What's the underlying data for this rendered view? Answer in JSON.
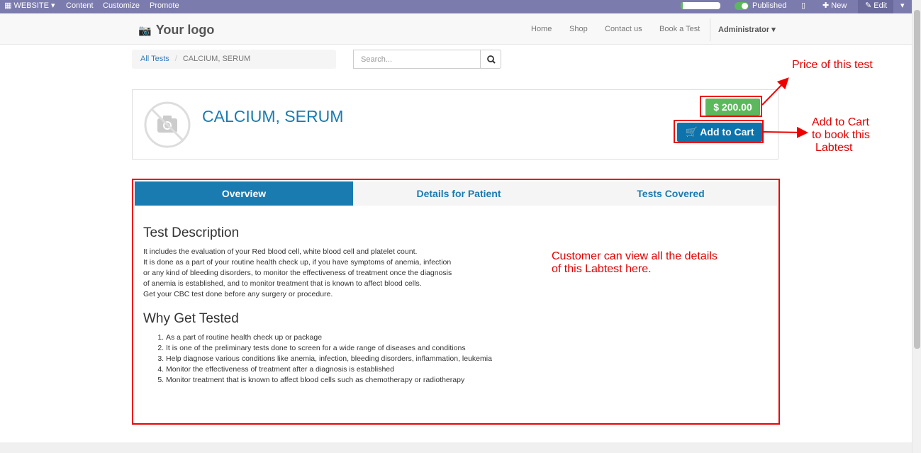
{
  "admin_bar": {
    "website_label": "WEBSITE",
    "content_label": "Content",
    "customize_label": "Customize",
    "promote_label": "Promote",
    "progress": 0.05,
    "published_label": "Published",
    "new_label": "New",
    "edit_label": "Edit"
  },
  "navbar": {
    "logo_text": "Your logo",
    "links": [
      "Home",
      "Shop",
      "Contact us",
      "Book a Test"
    ],
    "user_label": "Administrator"
  },
  "breadcrumb": {
    "root": "All Tests",
    "current": "CALCIUM, SERUM"
  },
  "search": {
    "placeholder": "Search..."
  },
  "product": {
    "title": "CALCIUM, SERUM",
    "price": "$ 200.00",
    "add_to_cart_label": "Add to Cart"
  },
  "tabs": [
    "Overview",
    "Details for Patient",
    "Tests Covered"
  ],
  "overview": {
    "heading1": "Test Description",
    "desc_lines": [
      "It includes the evaluation of your Red blood cell, white blood cell and platelet count.",
      "It is done as a part of your routine health check up, if you have symptoms of anemia, infection",
      "or any kind of bleeding disorders, to monitor the effectiveness of treatment once the diagnosis",
      "of anemia is established, and to monitor treatment that is known to affect blood cells.",
      "Get your CBC test done before any surgery or procedure."
    ],
    "heading2": "Why Get Tested",
    "reasons": [
      "As a part of routine health check up or package",
      "It is one of the preliminary tests done to screen for a wide range of diseases and conditions",
      "Help diagnose various conditions like anemia, infection, bleeding disorders, inflammation, leukemia",
      "Monitor the effectiveness of treatment after a diagnosis is established",
      "Monitor treatment that is known to affect blood cells such as chemotherapy or radiotherapy"
    ]
  },
  "annotations": {
    "price": "Price of this test",
    "cart_line1": "Add to Cart",
    "cart_line2": "to book this",
    "cart_line3": "Labtest",
    "details_line1": "Customer can view all the details",
    "details_line2": "of this Labtest here."
  },
  "colors": {
    "admin_bar": "#7c7bad",
    "accent": "#1a7bb1",
    "price_green": "#5cb85c",
    "annotation_red": "#ee0000"
  }
}
